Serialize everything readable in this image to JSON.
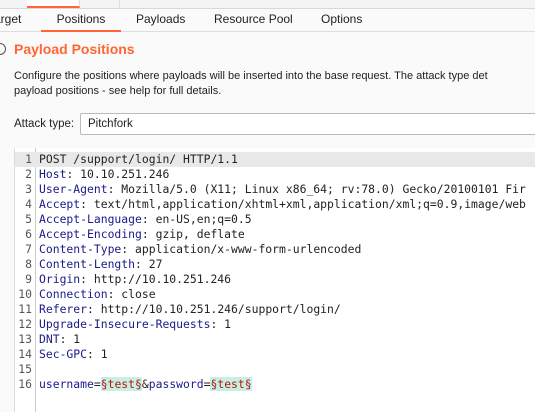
{
  "tabs": [
    {
      "label": "Target"
    },
    {
      "label": "Positions",
      "active": true
    },
    {
      "label": "Payloads"
    },
    {
      "label": "Resource Pool"
    },
    {
      "label": "Options"
    }
  ],
  "section": {
    "title": "Payload Positions",
    "description_line1": "Configure the positions where payloads will be inserted into the base request. The attack type det",
    "description_line2": "payload positions - see help for full details.",
    "attack_type_label": "Attack type:",
    "attack_type_value": "Pitchfork"
  },
  "request": [
    {
      "n": "1",
      "text": "POST /support/login/ HTTP/1.1"
    },
    {
      "n": "2",
      "h": "Host",
      "v": ": 10.10.251.246"
    },
    {
      "n": "3",
      "h": "User-Agent",
      "v": ": Mozilla/5.0 (X11; Linux x86_64; rv:78.0) Gecko/20100101 Fir"
    },
    {
      "n": "4",
      "h": "Accept",
      "v": ": text/html,application/xhtml+xml,application/xml;q=0.9,image/web"
    },
    {
      "n": "5",
      "h": "Accept-Language",
      "v": ": en-US,en;q=0.5"
    },
    {
      "n": "6",
      "h": "Accept-Encoding",
      "v": ": gzip, deflate"
    },
    {
      "n": "7",
      "h": "Content-Type",
      "v": ": application/x-www-form-urlencoded"
    },
    {
      "n": "8",
      "h": "Content-Length",
      "v": ": 27"
    },
    {
      "n": "9",
      "h": "Origin",
      "v": ": http://10.10.251.246"
    },
    {
      "n": "10",
      "h": "Connection",
      "v": ": close"
    },
    {
      "n": "11",
      "h": "Referer",
      "v": ": http://10.10.251.246/support/login/"
    },
    {
      "n": "12",
      "h": "Upgrade-Insecure-Requests",
      "v": ": 1"
    },
    {
      "n": "13",
      "h": "DNT",
      "v": ": 1"
    },
    {
      "n": "14",
      "h": "Sec-GPC",
      "v": ": 1"
    },
    {
      "n": "15",
      "text": ""
    },
    {
      "n": "16",
      "body": {
        "p1": "username",
        "eq1": "=",
        "m1": "§test§",
        "amp": "&",
        "p2": "password",
        "eq2": "=",
        "m2": "§test§"
      }
    }
  ]
}
